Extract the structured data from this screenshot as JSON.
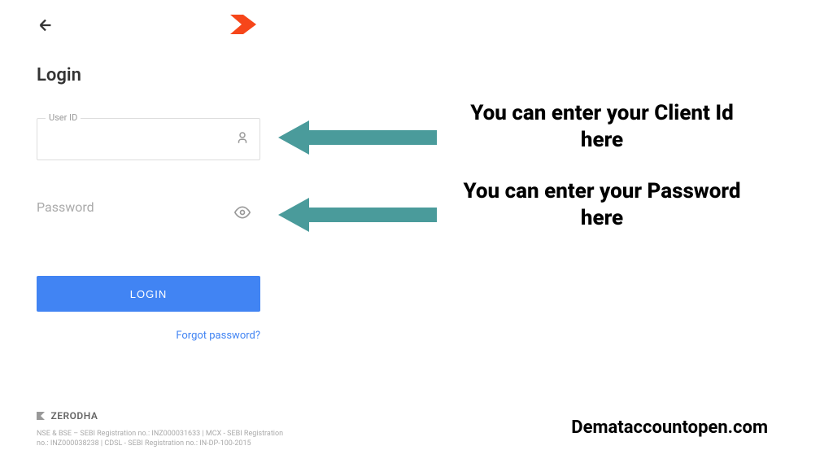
{
  "login": {
    "title": "Login",
    "user_id_label": "User ID",
    "password_placeholder": "Password",
    "button_label": "LOGIN",
    "forgot_password": "Forgot password?"
  },
  "annotations": {
    "client_id": "You can enter your Client Id here",
    "password": "You can enter your Password here"
  },
  "footer": {
    "brand": "ZERODHA",
    "disclaimer": "NSE & BSE – SEBI Registration no.: INZ000031633 | MCX - SEBI Registration no.: INZ000038238 | CDSL - SEBI Registration no.: IN-DP-100-2015"
  },
  "watermark": "Demataccountopen.com",
  "colors": {
    "primary": "#4184f3",
    "arrow": "#4a9b9b",
    "logo": "#f6461a"
  }
}
